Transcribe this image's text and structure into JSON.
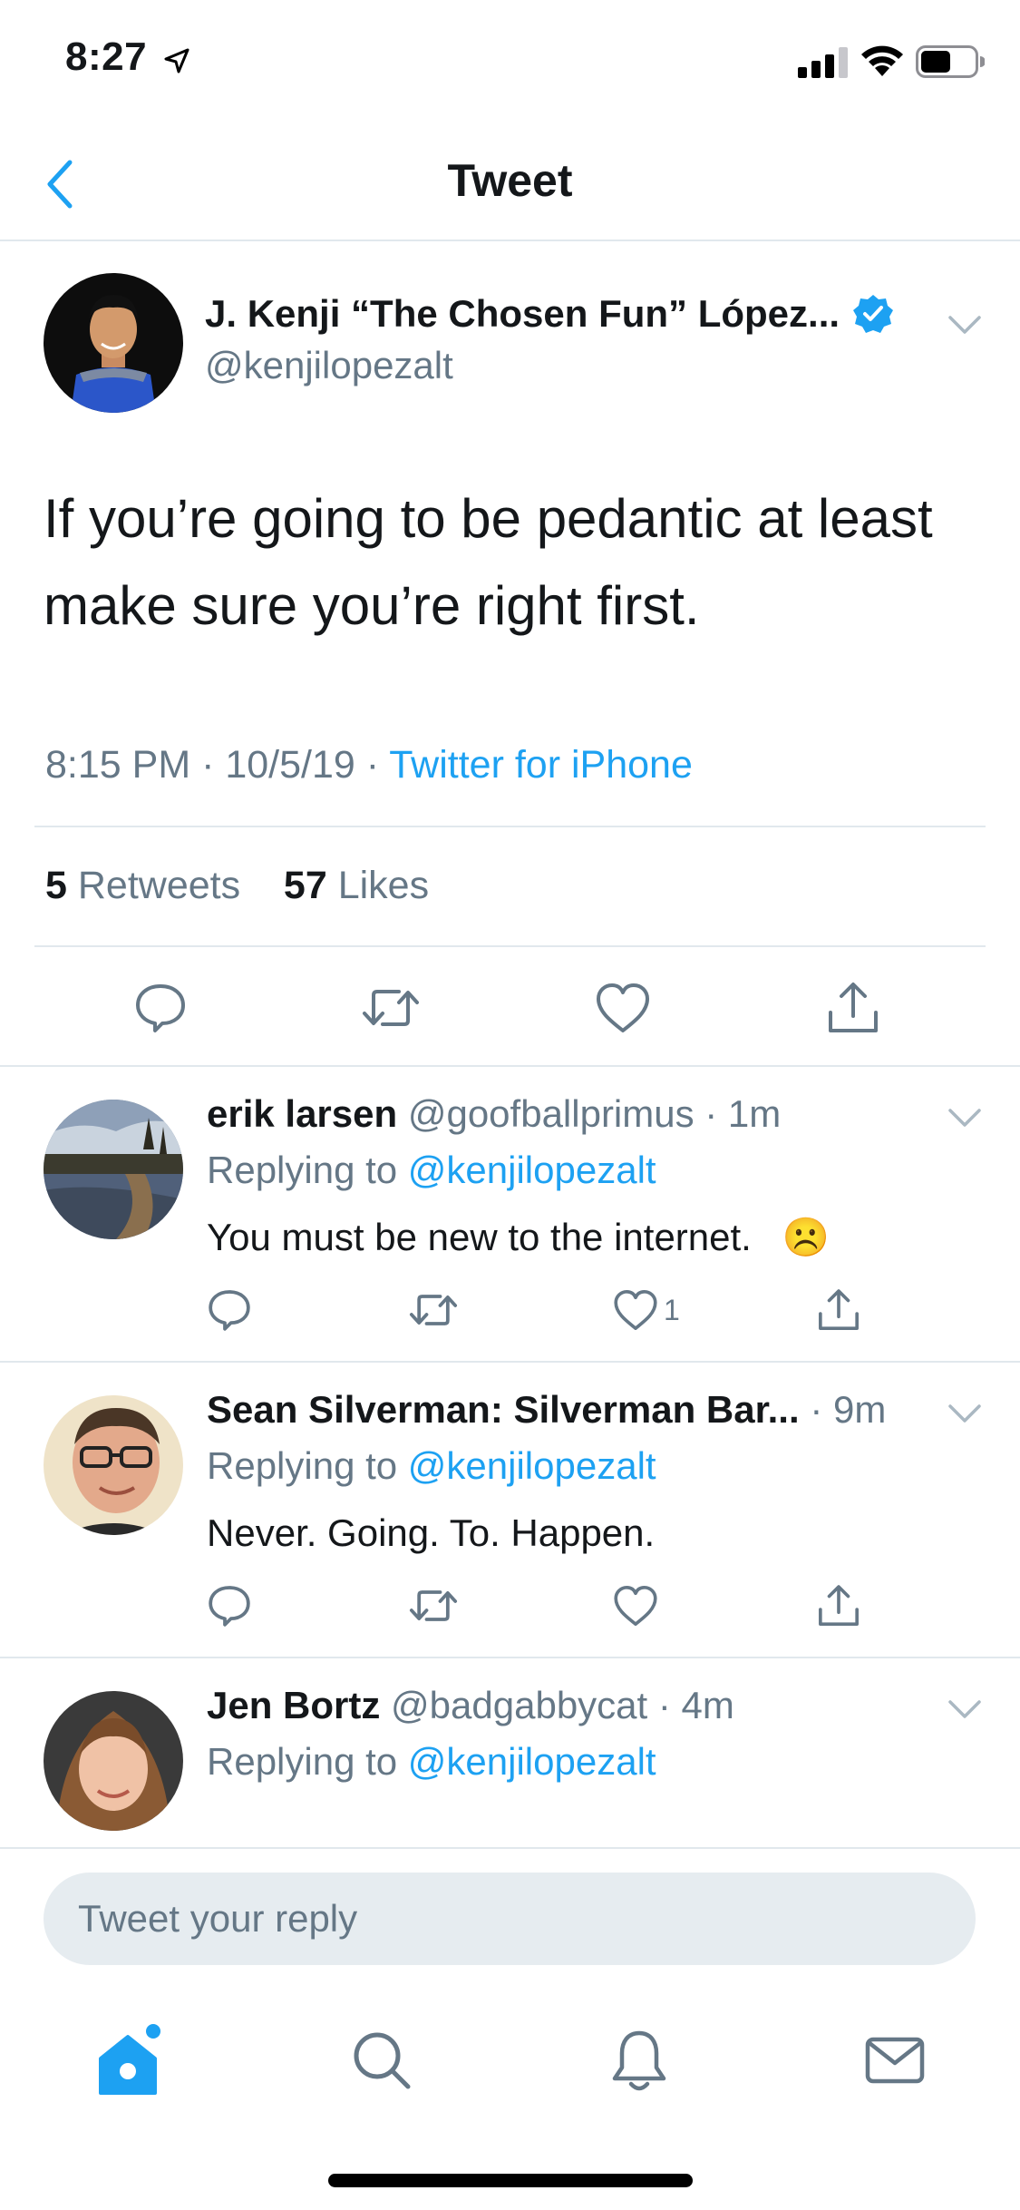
{
  "status_bar": {
    "time": "8:27"
  },
  "nav": {
    "title": "Tweet"
  },
  "tweet": {
    "author_name": "J. Kenji “The Chosen Fun” López...",
    "handle": "@kenjilopezalt",
    "text": "If you’re going to be pedantic at least make sure you’re right first.",
    "timestamp": "8:15 PM · 10/5/19 · ",
    "source": "Twitter for iPhone",
    "retweets_count": "5",
    "retweets_label": " Retweets",
    "likes_count": "57",
    "likes_label": " Likes"
  },
  "replies": [
    {
      "name": "erik larsen",
      "meta": " @goofballprimus · 1m",
      "replying_prefix": "Replying to ",
      "replying_to": "@kenjilopezalt",
      "text": "You must be new to the internet.",
      "emoji": "☹️",
      "like_count": "1"
    },
    {
      "name": "Sean Silverman: Silverman Bar...",
      "meta": " · 9m",
      "replying_prefix": "Replying to ",
      "replying_to": "@kenjilopezalt",
      "text": "Never. Going. To. Happen."
    },
    {
      "name": "Jen Bortz",
      "meta": " @badgabbycat · 4m",
      "replying_prefix": "Replying to ",
      "replying_to": "@kenjilopezalt"
    }
  ],
  "compose": {
    "placeholder": "Tweet your reply"
  },
  "colors": {
    "accent": "#1da1f2",
    "secondary_text": "#657786",
    "divider": "#e1e8ed"
  },
  "icons": [
    "back-chevron-icon",
    "verified-badge-icon",
    "reply-icon",
    "retweet-icon",
    "like-icon",
    "share-icon",
    "home-icon",
    "search-icon",
    "notifications-icon",
    "messages-icon"
  ]
}
